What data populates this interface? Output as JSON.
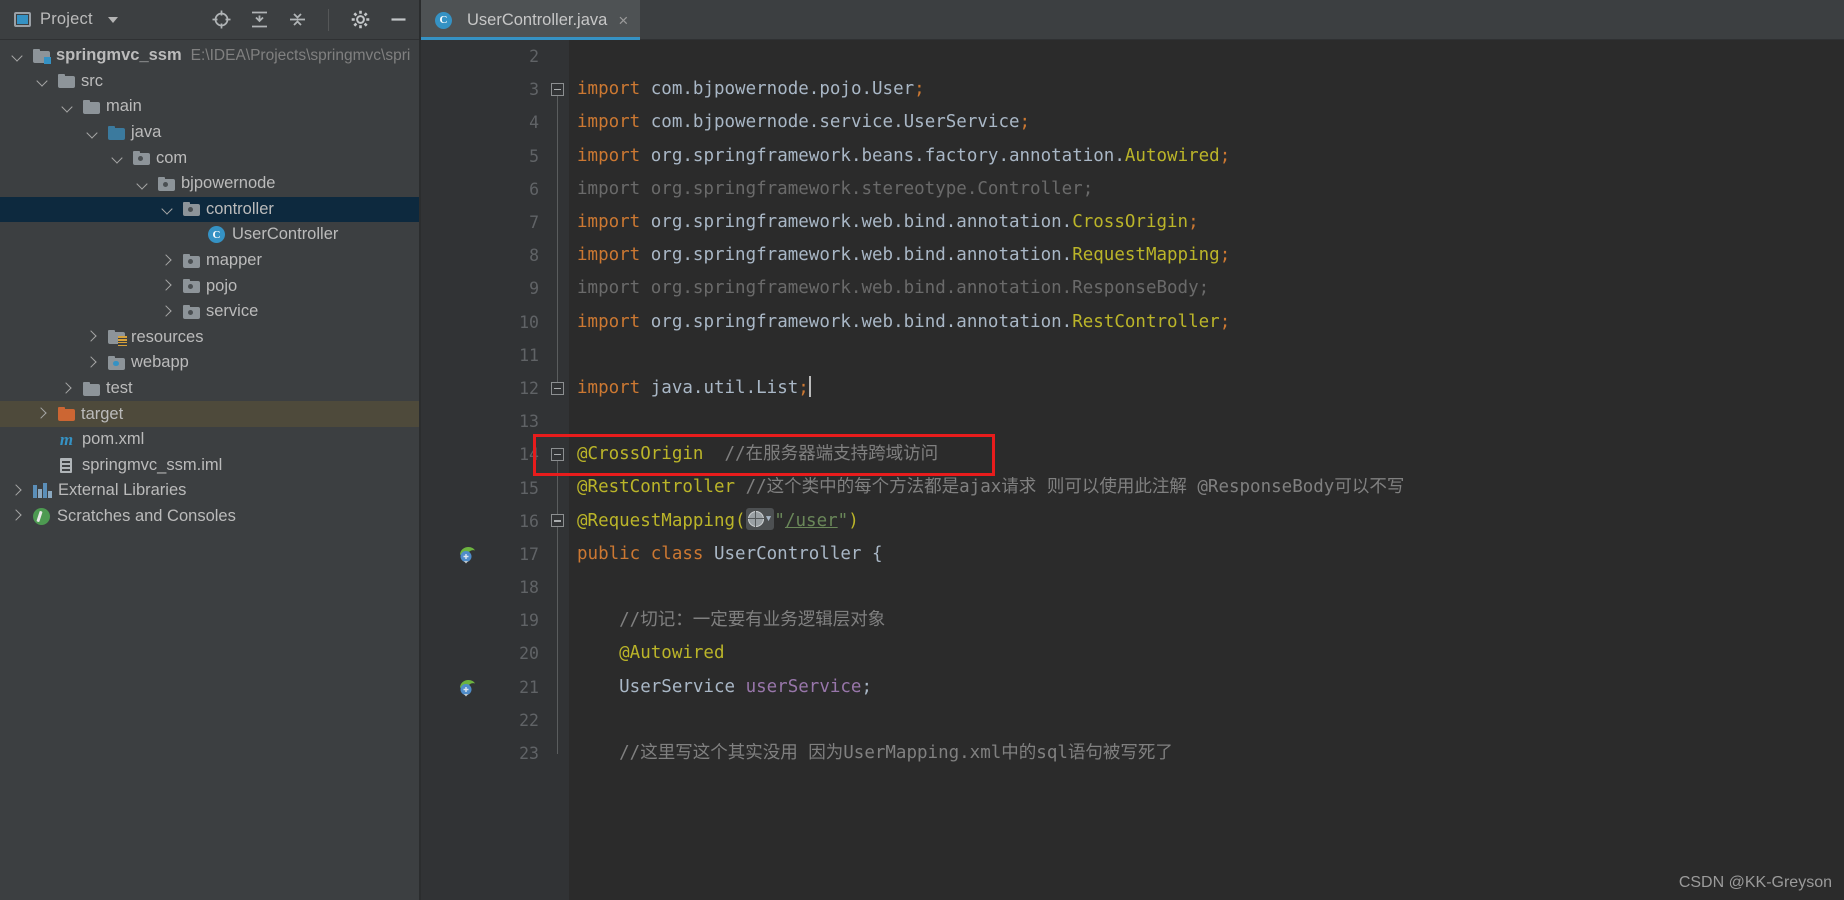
{
  "project_panel": {
    "title": "Project",
    "icons": [
      "locate-icon",
      "expand-all-icon",
      "collapse-all-icon",
      "gear-icon",
      "minimize-icon"
    ],
    "tree": [
      {
        "indent": 0,
        "twisty": "down",
        "icon": "module-folder-icon",
        "label": "springmvc_ssm",
        "bold": true,
        "secondary": "E:\\IDEA\\Projects\\springmvc\\spri",
        "state": "normal"
      },
      {
        "indent": 1,
        "twisty": "down",
        "icon": "folder-icon",
        "label": "src",
        "state": "normal"
      },
      {
        "indent": 2,
        "twisty": "down",
        "icon": "folder-icon",
        "label": "main",
        "state": "normal"
      },
      {
        "indent": 3,
        "twisty": "down",
        "icon": "source-folder-icon",
        "label": "java",
        "state": "normal"
      },
      {
        "indent": 4,
        "twisty": "down",
        "icon": "package-icon",
        "label": "com",
        "state": "normal"
      },
      {
        "indent": 5,
        "twisty": "down",
        "icon": "package-icon",
        "label": "bjpowernode",
        "state": "normal"
      },
      {
        "indent": 6,
        "twisty": "down",
        "icon": "package-icon",
        "label": "controller",
        "state": "selected"
      },
      {
        "indent": 7,
        "twisty": "none",
        "icon": "java-class-icon",
        "label": "UserController",
        "state": "normal"
      },
      {
        "indent": 6,
        "twisty": "right",
        "icon": "package-icon",
        "label": "mapper",
        "state": "normal"
      },
      {
        "indent": 6,
        "twisty": "right",
        "icon": "package-icon",
        "label": "pojo",
        "state": "normal"
      },
      {
        "indent": 6,
        "twisty": "right",
        "icon": "package-icon",
        "label": "service",
        "state": "normal"
      },
      {
        "indent": 3,
        "twisty": "right",
        "icon": "resources-folder-icon",
        "label": "resources",
        "state": "normal"
      },
      {
        "indent": 3,
        "twisty": "right",
        "icon": "webapp-folder-icon",
        "label": "webapp",
        "state": "normal"
      },
      {
        "indent": 2,
        "twisty": "right",
        "icon": "folder-icon",
        "label": "test",
        "state": "normal"
      },
      {
        "indent": 1,
        "twisty": "right",
        "icon": "excluded-folder-icon",
        "label": "target",
        "state": "highlighted"
      },
      {
        "indent": 1,
        "twisty": "none",
        "icon": "maven-pom-icon",
        "label": "pom.xml",
        "state": "normal"
      },
      {
        "indent": 1,
        "twisty": "none",
        "icon": "iml-file-icon",
        "label": "springmvc_ssm.iml",
        "state": "normal"
      },
      {
        "indent": 0,
        "twisty": "right",
        "icon": "external-libraries-icon",
        "label": "External Libraries",
        "state": "normal"
      },
      {
        "indent": 0,
        "twisty": "right",
        "icon": "scratches-icon",
        "label": "Scratches and Consoles",
        "state": "normal"
      }
    ]
  },
  "editor": {
    "tab": {
      "label": "UserController.java",
      "icon": "java-class-icon",
      "close": "×"
    },
    "first_line_number": 2,
    "lines": [
      {
        "num": 2,
        "tokens": []
      },
      {
        "num": 3,
        "fold": "start",
        "tokens": [
          {
            "t": "import ",
            "c": "kw"
          },
          {
            "t": "com.bjpowernode.pojo.User",
            "c": "pkg"
          },
          {
            "t": ";",
            "c": "kw"
          }
        ]
      },
      {
        "num": 4,
        "tokens": [
          {
            "t": "import ",
            "c": "kw"
          },
          {
            "t": "com.bjpowernode.service.UserService",
            "c": "pkg"
          },
          {
            "t": ";",
            "c": "kw"
          }
        ]
      },
      {
        "num": 5,
        "tokens": [
          {
            "t": "import ",
            "c": "kw"
          },
          {
            "t": "org.springframework.beans.factory.annotation.",
            "c": "pkg"
          },
          {
            "t": "Autowired",
            "c": "ann"
          },
          {
            "t": ";",
            "c": "kw"
          }
        ]
      },
      {
        "num": 6,
        "tokens": [
          {
            "t": "import org.springframework.stereotype.Controller;",
            "c": "dim"
          }
        ]
      },
      {
        "num": 7,
        "tokens": [
          {
            "t": "import ",
            "c": "kw"
          },
          {
            "t": "org.springframework.web.bind.annotation.",
            "c": "pkg"
          },
          {
            "t": "CrossOrigin",
            "c": "ann"
          },
          {
            "t": ";",
            "c": "kw"
          }
        ]
      },
      {
        "num": 8,
        "tokens": [
          {
            "t": "import ",
            "c": "kw"
          },
          {
            "t": "org.springframework.web.bind.annotation.",
            "c": "pkg"
          },
          {
            "t": "RequestMapping",
            "c": "ann"
          },
          {
            "t": ";",
            "c": "kw"
          }
        ]
      },
      {
        "num": 9,
        "tokens": [
          {
            "t": "import org.springframework.web.bind.annotation.ResponseBody;",
            "c": "dim"
          }
        ]
      },
      {
        "num": 10,
        "tokens": [
          {
            "t": "import ",
            "c": "kw"
          },
          {
            "t": "org.springframework.web.bind.annotation.",
            "c": "pkg"
          },
          {
            "t": "RestController",
            "c": "ann"
          },
          {
            "t": ";",
            "c": "kw"
          }
        ]
      },
      {
        "num": 11,
        "tokens": []
      },
      {
        "num": 12,
        "fold": "end",
        "caret": true,
        "tokens": [
          {
            "t": "import ",
            "c": "kw"
          },
          {
            "t": "java.util.List",
            "c": "pkg"
          },
          {
            "t": ";",
            "c": "kw"
          }
        ]
      },
      {
        "num": 13,
        "tokens": []
      },
      {
        "num": 14,
        "fold": "start",
        "boxed": true,
        "tokens": [
          {
            "t": "@CrossOrigin",
            "c": "ann"
          },
          {
            "t": "  ",
            "c": "pkg"
          },
          {
            "t": "//在服务器端支持跨域访问",
            "c": "cmt"
          }
        ]
      },
      {
        "num": 15,
        "tokens": [
          {
            "t": "@RestController",
            "c": "ann"
          },
          {
            "t": " ",
            "c": "pkg"
          },
          {
            "t": "//这个类中的每个方法都是ajax请求 则可以使用此注解 @ResponseBody可以不写",
            "c": "cmt"
          }
        ]
      },
      {
        "num": 16,
        "fold": "start",
        "widget": true,
        "tokens": [
          {
            "t": "@RequestMapping",
            "c": "ann"
          },
          {
            "t": "(",
            "c": "ann"
          }
        ],
        "tail": [
          {
            "t": "\"",
            "c": "str"
          },
          {
            "t": "/user",
            "c": "str",
            "underline": true
          },
          {
            "t": "\"",
            "c": "str"
          },
          {
            "t": ")",
            "c": "ann"
          }
        ]
      },
      {
        "num": 17,
        "gutter_icon": "spring-bean-icon",
        "tokens": [
          {
            "t": "public class ",
            "c": "kw"
          },
          {
            "t": "UserController",
            "c": "cls"
          },
          {
            "t": " {",
            "c": "cls"
          }
        ]
      },
      {
        "num": 18,
        "tokens": []
      },
      {
        "num": 19,
        "tokens": [
          {
            "t": "    //切记：一定要有业务逻辑层对象",
            "c": "cmt"
          }
        ]
      },
      {
        "num": 20,
        "tokens": [
          {
            "t": "    @Autowired",
            "c": "ann"
          }
        ]
      },
      {
        "num": 21,
        "gutter_icon": "spring-bean-icon",
        "tokens": [
          {
            "t": "    UserService ",
            "c": "cls"
          },
          {
            "t": "userService",
            "c": "fld"
          },
          {
            "t": ";",
            "c": "cls"
          }
        ]
      },
      {
        "num": 22,
        "tokens": []
      },
      {
        "num": 23,
        "tokens": [
          {
            "t": "    //这里写这个其实没用 因为UserMapping.xml中的sql语句被写死了",
            "c": "cmt"
          }
        ]
      }
    ]
  },
  "watermark": "CSDN @KK-Greyson",
  "colors": {
    "panel_bg": "#3c3f41",
    "editor_bg": "#2b2b2b",
    "gutter_bg": "#313335",
    "selection_blue": "#0d293e",
    "selection_brown": "#4e4a3b",
    "accent_blue": "#3592c4",
    "keyword_orange": "#cc7832",
    "annotation_yellow": "#bbb529",
    "comment_gray": "#808080",
    "string_green": "#6a8759",
    "field_purple": "#9876aa",
    "annotation_box_red": "#e81c1c"
  }
}
